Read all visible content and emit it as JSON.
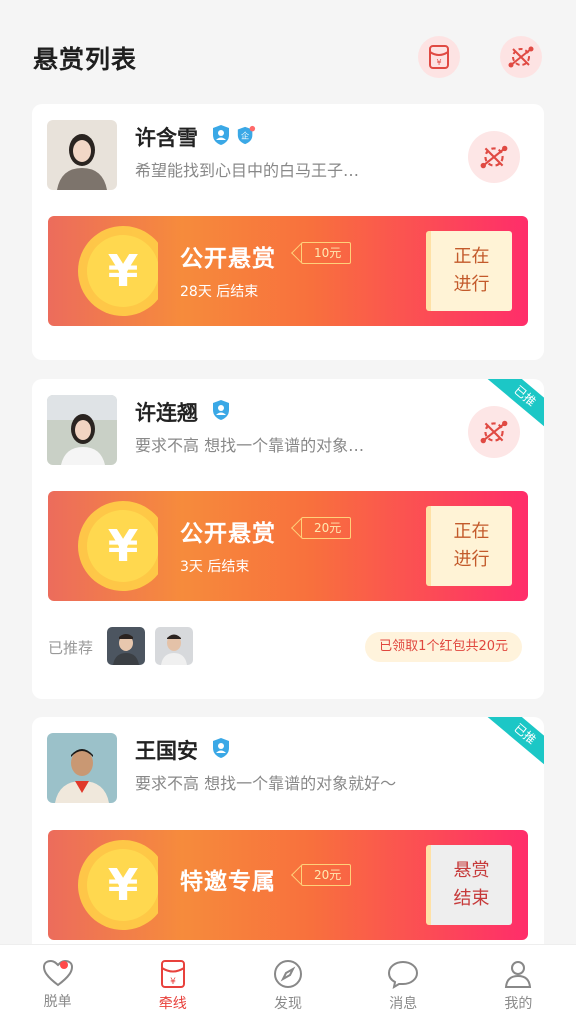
{
  "header": {
    "title": "悬赏列表"
  },
  "cards": [
    {
      "name": "许含雪",
      "desc": "希望能找到心目中的白马王子…",
      "banner_title": "公开悬赏",
      "tag": "10元",
      "sub": "28天 后结束",
      "status_line1": "正在",
      "status_line2": "进行"
    },
    {
      "name": "许连翘",
      "desc": "要求不高 想找一个靠谱的对象…",
      "ribbon": "已推",
      "banner_title": "公开悬赏",
      "tag": "20元",
      "sub": "3天 后结束",
      "status_line1": "正在",
      "status_line2": "进行",
      "recommended_label": "已推荐",
      "reward_info": "已领取1个红包共20元"
    },
    {
      "name": "王国安",
      "desc": "要求不高 想找一个靠谱的对象就好～",
      "ribbon": "已推",
      "banner_title": "特邀专属",
      "tag": "20元",
      "status_line1": "悬赏",
      "status_line2": "结束"
    }
  ],
  "tabbar": [
    {
      "label": "脱单",
      "icon": "heart-icon"
    },
    {
      "label": "牵线",
      "icon": "red-envelope-icon"
    },
    {
      "label": "发现",
      "icon": "compass-icon"
    },
    {
      "label": "消息",
      "icon": "chat-icon"
    },
    {
      "label": "我的",
      "icon": "user-icon"
    }
  ],
  "colors": {
    "accent": "#e8413c",
    "ribbon": "#1cc7c6",
    "banner_start": "#ec6c5c",
    "banner_end": "#ff2d6a"
  }
}
